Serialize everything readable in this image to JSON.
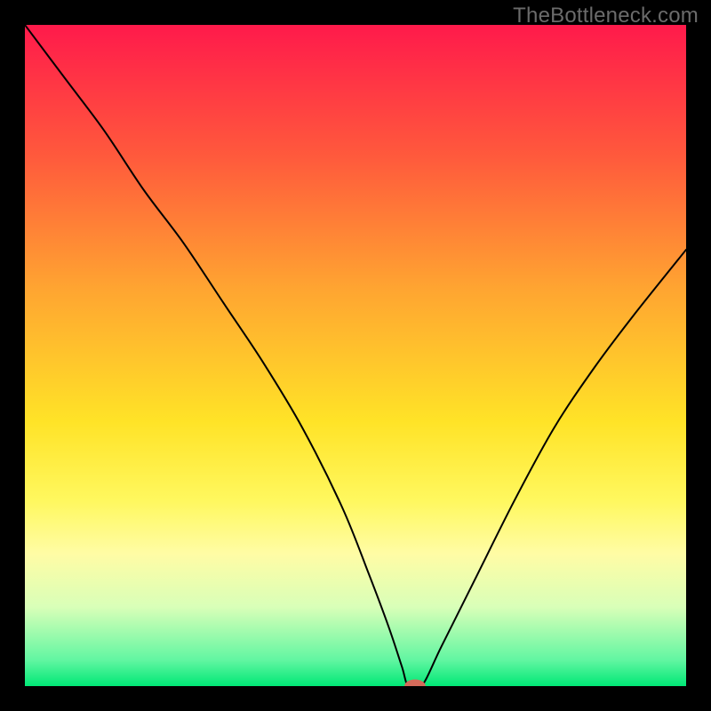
{
  "watermark": "TheBottleneck.com",
  "chart_data": {
    "type": "line",
    "title": "",
    "xlabel": "",
    "ylabel": "",
    "xlim": [
      0,
      100
    ],
    "ylim": [
      0,
      100
    ],
    "background_gradient": {
      "stops": [
        {
          "pct": 0,
          "color": "#ff1a4b"
        },
        {
          "pct": 20,
          "color": "#ff5a3c"
        },
        {
          "pct": 40,
          "color": "#ffa531"
        },
        {
          "pct": 60,
          "color": "#ffe327"
        },
        {
          "pct": 72,
          "color": "#fff85f"
        },
        {
          "pct": 80,
          "color": "#fffca5"
        },
        {
          "pct": 88,
          "color": "#d9ffb8"
        },
        {
          "pct": 96,
          "color": "#63f6a2"
        },
        {
          "pct": 100,
          "color": "#00e876"
        }
      ]
    },
    "series": [
      {
        "name": "bottleneck-curve",
        "color": "#000000",
        "x": [
          0,
          6,
          12,
          18,
          24,
          30,
          36,
          42,
          48,
          52,
          55,
          57,
          58,
          60,
          63,
          68,
          74,
          80,
          86,
          92,
          100
        ],
        "y": [
          100,
          92,
          84,
          75,
          67,
          58,
          49,
          39,
          27,
          17,
          9,
          3,
          0,
          0,
          6,
          16,
          28,
          39,
          48,
          56,
          66
        ]
      }
    ],
    "marker": {
      "x": 59,
      "y": 0,
      "color": "#d46a5a",
      "rx": 1.6,
      "ry": 1.0
    }
  }
}
